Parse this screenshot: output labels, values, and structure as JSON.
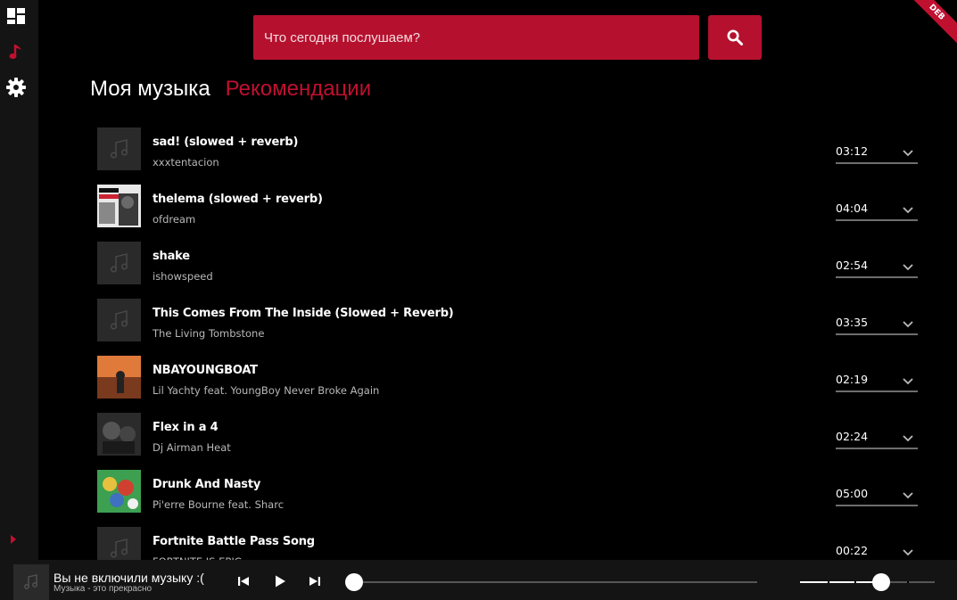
{
  "ribbon": {
    "text": "DEB"
  },
  "sidebar": {
    "items": [
      {
        "name": "dashboard",
        "icon": "dashboard-icon"
      },
      {
        "name": "music",
        "icon": "music-note-icon",
        "active": true
      },
      {
        "name": "settings",
        "icon": "gear-icon"
      }
    ],
    "expand_icon": "expand-arrow-icon"
  },
  "search": {
    "placeholder": "Что сегодня послушаем?",
    "value": "",
    "icon": "search-icon"
  },
  "tabs": [
    {
      "label": "Моя музыка",
      "active": true
    },
    {
      "label": "Рекомендации",
      "active": false
    }
  ],
  "colors": {
    "accent": "#c01030",
    "search_bg": "#b5112e",
    "sidebar_bg": "#141414",
    "background": "#000000",
    "muted_text": "#b8b8b8"
  },
  "tracks": [
    {
      "title": "sad! (slowed + reverb)",
      "artist": "xxxtentacion",
      "duration": "03:12",
      "cover": "placeholder"
    },
    {
      "title": "thelema (slowed + reverb)",
      "artist": "ofdream",
      "duration": "04:04",
      "cover": "artwork"
    },
    {
      "title": "shake",
      "artist": "ishowspeed",
      "duration": "02:54",
      "cover": "placeholder"
    },
    {
      "title": "This Comes From The Inside (Slowed + Reverb)",
      "artist": "The Living Tombstone",
      "duration": "03:35",
      "cover": "placeholder"
    },
    {
      "title": "NBAYOUNGBOAT",
      "artist": "Lil Yachty feat. YoungBoy Never Broke Again",
      "duration": "02:19",
      "cover": "artwork"
    },
    {
      "title": "Flex in a 4",
      "artist": "Dj Airman Heat",
      "duration": "02:24",
      "cover": "artwork"
    },
    {
      "title": "Drunk And Nasty",
      "artist": "Pi'erre Bourne feat. Sharc",
      "duration": "05:00",
      "cover": "artwork"
    },
    {
      "title": "Fortnite Battle Pass Song",
      "artist": "FORTNITE IS EPIC",
      "duration": "00:22",
      "cover": "placeholder"
    }
  ],
  "player": {
    "title": "Вы не включили музыку :(",
    "subtitle": "Музыка - это прекрасно",
    "progress": 0,
    "volume": 0.6
  }
}
